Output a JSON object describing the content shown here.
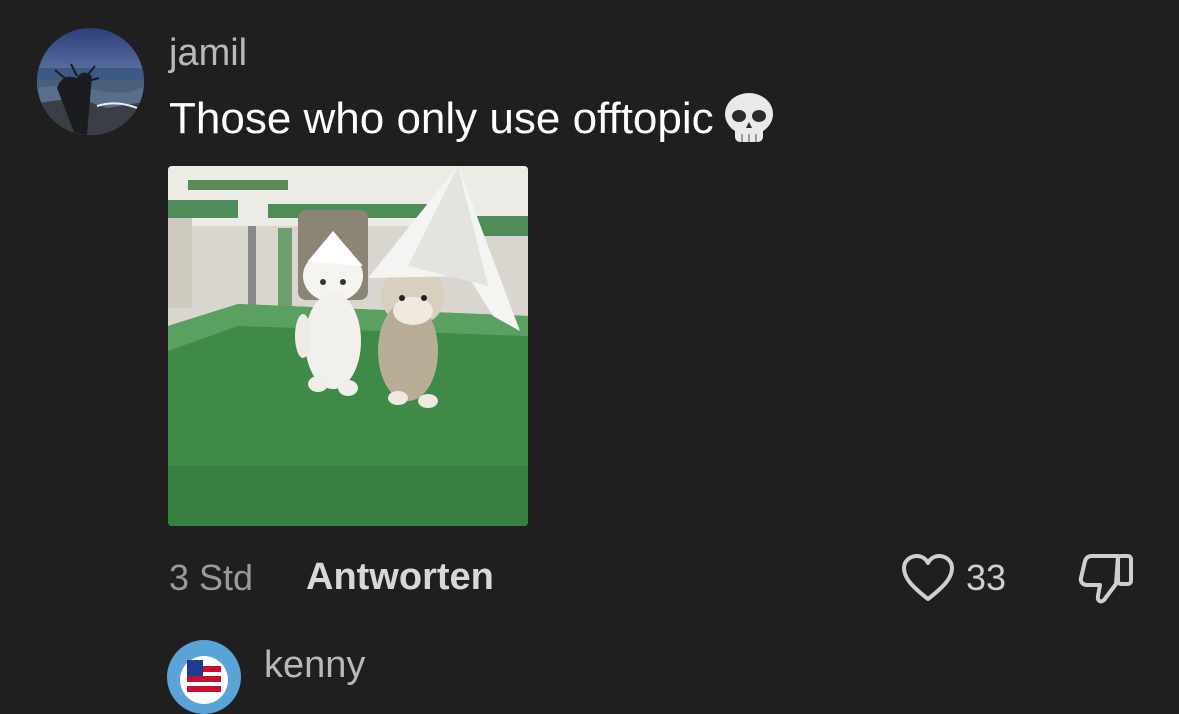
{
  "comment": {
    "username": "jamil",
    "text": "Those who only use offtopic",
    "emoji_icon": "skull-emoji",
    "attachment": "kittens-paper-hats-image",
    "timestamp": "3 Std",
    "reply_label": "Antworten",
    "like_count": "33"
  },
  "next_comment": {
    "username": "kenny"
  },
  "colors": {
    "background": "#1f1f1f",
    "username": "#b9b9b9",
    "text": "#ffffff",
    "meta": "#9a9a9a"
  }
}
